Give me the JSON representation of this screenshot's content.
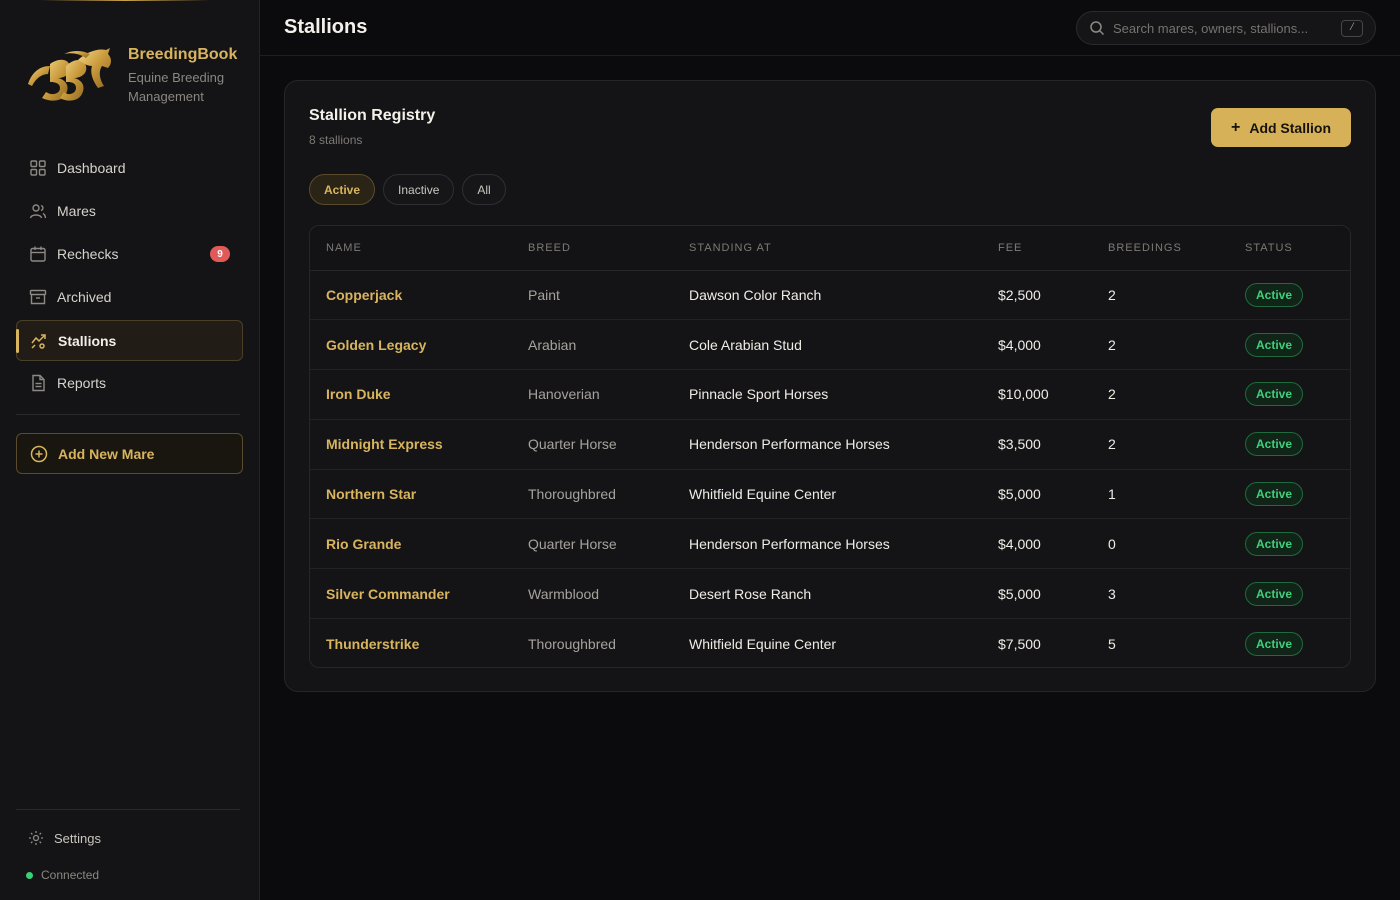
{
  "app": {
    "name": "BreedingBook",
    "subtitle": "Equine Breeding Management"
  },
  "sidebar": {
    "items": [
      {
        "label": "Dashboard",
        "icon": "grid-icon"
      },
      {
        "label": "Mares",
        "icon": "users-icon"
      },
      {
        "label": "Rechecks",
        "icon": "calendar-icon",
        "badge": "9"
      },
      {
        "label": "Archived",
        "icon": "archive-icon"
      },
      {
        "label": "Stallions",
        "icon": "trend-icon",
        "active": true
      },
      {
        "label": "Reports",
        "icon": "document-icon"
      }
    ],
    "add_mare_label": "Add New Mare",
    "settings_label": "Settings",
    "connection_status": "Connected"
  },
  "header": {
    "title": "Stallions",
    "search_placeholder": "Search mares, owners, stallions...",
    "search_shortcut": "/"
  },
  "registry": {
    "title": "Stallion Registry",
    "count_text": "8 stallions",
    "add_button_label": "Add Stallion",
    "filters": [
      "Active",
      "Inactive",
      "All"
    ],
    "active_filter": "Active",
    "columns": [
      "NAME",
      "BREED",
      "STANDING AT",
      "FEE",
      "BREEDINGS",
      "STATUS"
    ],
    "rows": [
      {
        "name": "Copperjack",
        "breed": "Paint",
        "standing_at": "Dawson Color Ranch",
        "fee": "$2,500",
        "breedings": "2",
        "status": "Active"
      },
      {
        "name": "Golden Legacy",
        "breed": "Arabian",
        "standing_at": "Cole Arabian Stud",
        "fee": "$4,000",
        "breedings": "2",
        "status": "Active"
      },
      {
        "name": "Iron Duke",
        "breed": "Hanoverian",
        "standing_at": "Pinnacle Sport Horses",
        "fee": "$10,000",
        "breedings": "2",
        "status": "Active"
      },
      {
        "name": "Midnight Express",
        "breed": "Quarter Horse",
        "standing_at": "Henderson Performance Horses",
        "fee": "$3,500",
        "breedings": "2",
        "status": "Active"
      },
      {
        "name": "Northern Star",
        "breed": "Thoroughbred",
        "standing_at": "Whitfield Equine Center",
        "fee": "$5,000",
        "breedings": "1",
        "status": "Active"
      },
      {
        "name": "Rio Grande",
        "breed": "Quarter Horse",
        "standing_at": "Henderson Performance Horses",
        "fee": "$4,000",
        "breedings": "0",
        "status": "Active"
      },
      {
        "name": "Silver Commander",
        "breed": "Warmblood",
        "standing_at": "Desert Rose Ranch",
        "fee": "$5,000",
        "breedings": "3",
        "status": "Active"
      },
      {
        "name": "Thunderstrike",
        "breed": "Thoroughbred",
        "standing_at": "Whitfield Equine Center",
        "fee": "$7,500",
        "breedings": "5",
        "status": "Active"
      }
    ]
  },
  "colors": {
    "accent": "#d9b45e",
    "background": "#0b0b0d",
    "status_active": "#3fd07c",
    "badge": "#e05a5a"
  }
}
